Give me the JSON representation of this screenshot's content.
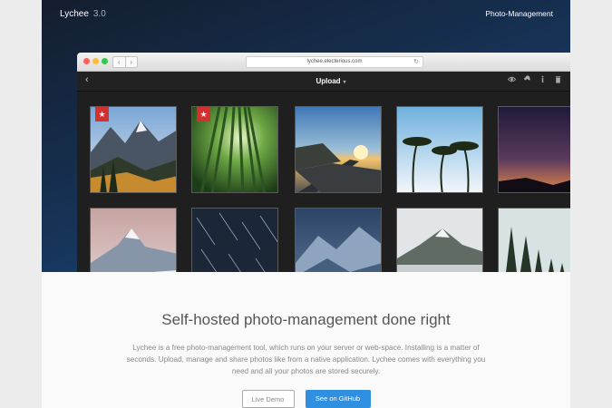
{
  "site": {
    "brand": "Lychee",
    "version": "3.0",
    "nav_link": "Photo-Management"
  },
  "browser": {
    "url": "lychee.electerious.com",
    "nav_back": "‹",
    "nav_forward": "›",
    "reload": "↻"
  },
  "app": {
    "back_icon": "‹",
    "title": "Upload",
    "title_caret": "▾",
    "tools": [
      "eye-icon",
      "cloud-upload-icon",
      "info-icon",
      "trash-icon",
      "plus-icon"
    ]
  },
  "photos": [
    {
      "name": "mountain-valley",
      "starred": true,
      "star": "★"
    },
    {
      "name": "bamboo-forest",
      "starred": true,
      "star": "★"
    },
    {
      "name": "sunset-road",
      "starred": false
    },
    {
      "name": "palm-trees",
      "starred": false
    },
    {
      "name": "night-sky",
      "starred": false
    },
    {
      "name": "snowy-peak",
      "starred": false
    },
    {
      "name": "star-trails",
      "starred": false
    },
    {
      "name": "icy-ridge",
      "starred": false
    },
    {
      "name": "misty-mountain",
      "starred": false
    },
    {
      "name": "pine-forest",
      "starred": false
    }
  ],
  "content": {
    "headline": "Self-hosted photo-management done right",
    "description": "Lychee is a free photo-management tool, which runs on your server or web-space. Installing is a matter of seconds. Upload, manage and share photos like from a native application. Lychee comes with everything you need and all your photos are stored securely.",
    "btn_demo": "Live Demo",
    "btn_github": "See on GitHub"
  },
  "colors": {
    "accent": "#2f8fe0",
    "star": "#d3302f",
    "hero_dark": "#141d2e",
    "hero_light": "#1a5aa0"
  }
}
